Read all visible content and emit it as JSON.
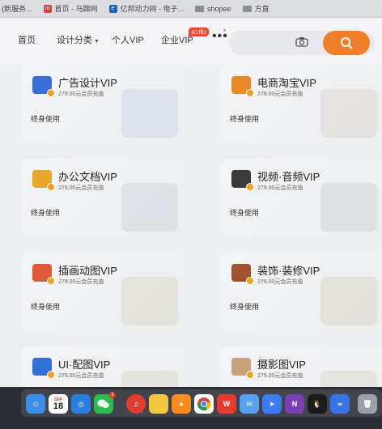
{
  "bookmarks": [
    {
      "label": "(新服务...",
      "icon": "page-icon",
      "color": "#b0b3b8"
    },
    {
      "label": "首页 - 马蹄网",
      "icon": "mayi-logo-icon",
      "color": "#e53935"
    },
    {
      "label": "亿邦动力网 - 电子...",
      "icon": "ebrun-logo-icon",
      "color": "#1565c0"
    },
    {
      "label": "shopee",
      "icon": "folder-icon",
      "color": "#8a8d92"
    },
    {
      "label": "方直",
      "icon": "folder-icon",
      "color": "#8a8d92"
    }
  ],
  "nav": {
    "home": "首页",
    "design_category": "设计分类",
    "personal_vip": "个人VIP",
    "enterprise_vip": "企业VIP",
    "enterprise_badge": "买1得3",
    "more": "•••",
    "accent_color": "#ef7d2a"
  },
  "cards": [
    {
      "title": "广告设计VIP",
      "price": "279.00元会员充值",
      "term": "终身使用",
      "icon_color": "#3b6fd8",
      "deco_color": "#c7d3e6"
    },
    {
      "title": "电商淘宝VIP",
      "price": "279.00元会员充值",
      "term": "终身使用",
      "icon_color": "#e8892b",
      "deco_color": "#d9d2c7"
    },
    {
      "title": "办公文档VIP",
      "price": "279.00元会员充值",
      "term": "终身使用",
      "icon_color": "#e8a72b",
      "deco_color": "#c9ced6"
    },
    {
      "title": "视频·音频VIP",
      "price": "279.00元会员充值",
      "term": "终身使用",
      "icon_color": "#3a3a3a",
      "deco_color": "#c9ccd2"
    },
    {
      "title": "插画动图VIP",
      "price": "279.00元会员充值",
      "term": "终身使用",
      "icon_color": "#e05a3a",
      "deco_color": "#d8d2c2"
    },
    {
      "title": "装饰·装修VIP",
      "price": "279.00元会员充值",
      "term": "终身使用",
      "icon_color": "#a0522d",
      "deco_color": "#d6cfc4"
    },
    {
      "title": "UI·配图VIP",
      "price": "279.00元会员充值",
      "term": "",
      "icon_color": "#2f6fd6",
      "deco_color": "#d9d3c4"
    },
    {
      "title": "摄影图VIP",
      "price": "279.00元会员充值",
      "term": "",
      "icon_color": "#c8a27a",
      "deco_color": "#ded6c8"
    }
  ],
  "dock": {
    "calendar_month": "SEP",
    "calendar_day": "18",
    "wechat_badge": "1",
    "apps": [
      {
        "name": "finder-icon",
        "color": "#3c8ee8"
      },
      {
        "name": "calendar-icon",
        "color": "#ffffff"
      },
      {
        "name": "safari-icon",
        "color": "#2a7de1"
      },
      {
        "name": "wechat-icon",
        "color": "#2dbb4e"
      },
      {
        "name": "netease-music-icon",
        "color": "#e03c31"
      },
      {
        "name": "notes-icon",
        "color": "#f5c842"
      },
      {
        "name": "app-orange-icon",
        "color": "#ff8a1e"
      },
      {
        "name": "chrome-icon",
        "color": "#ffffff"
      },
      {
        "name": "wps-icon",
        "color": "#e33b2e"
      },
      {
        "name": "chat-icon",
        "color": "#5aa0f0"
      },
      {
        "name": "feishu-icon",
        "color": "#3b7cf5"
      },
      {
        "name": "onenote-icon",
        "color": "#7b3fb3"
      },
      {
        "name": "qq-icon",
        "color": "#1c1c1c"
      },
      {
        "name": "baidu-netdisk-icon",
        "color": "#3a72e8"
      },
      {
        "name": "trash-icon",
        "color": "#9aa0a8"
      }
    ]
  }
}
